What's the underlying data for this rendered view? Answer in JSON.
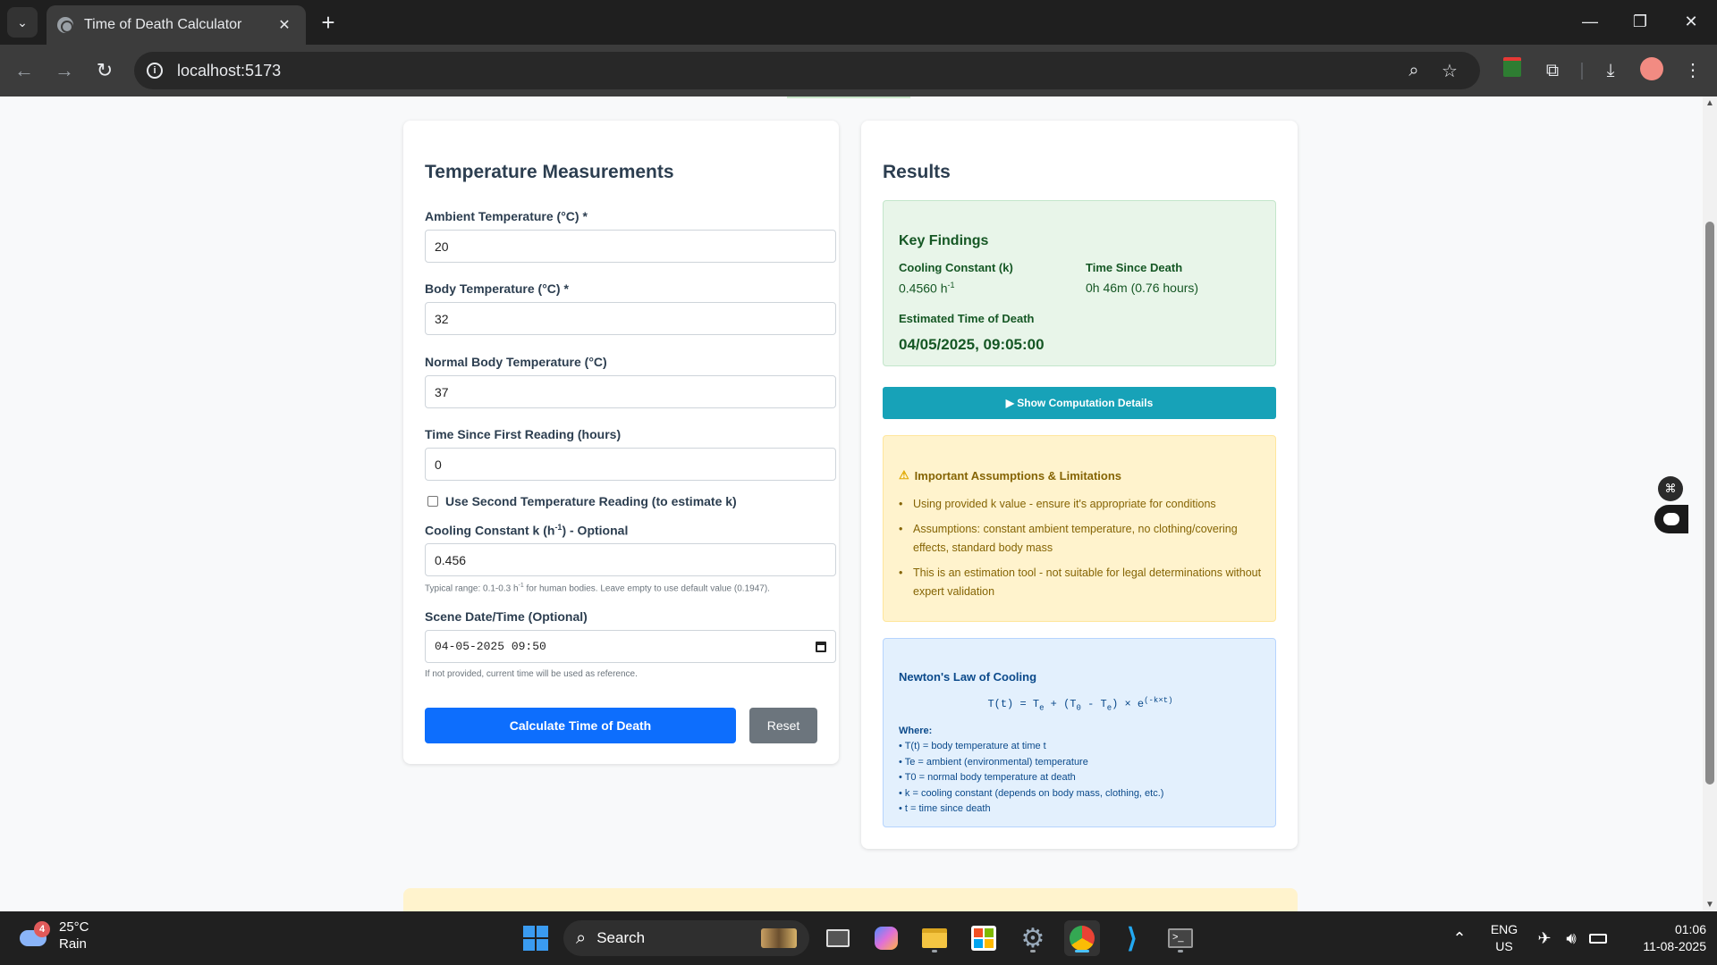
{
  "browser": {
    "tab_title": "Time of Death Calculator",
    "url": "localhost:5173",
    "new_tab": "+",
    "close_tab": "✕"
  },
  "form": {
    "title": "Temperature Measurements",
    "ambient_label": "Ambient Temperature (°C) *",
    "ambient_value": "20",
    "body_label": "Body Temperature (°C) *",
    "body_value": "32",
    "normal_label": "Normal Body Temperature (°C)",
    "normal_value": "37",
    "time_label": "Time Since First Reading (hours)",
    "time_value": "0",
    "second_reading_label": "Use Second Temperature Reading (to estimate k)",
    "k_label_prefix": "Cooling Constant k (h",
    "k_label_sup": "-1",
    "k_label_suffix": ") - Optional",
    "k_value": "0.456",
    "k_help_prefix": "Typical range: 0.1-0.3 h",
    "k_help_sup": "-1",
    "k_help_suffix": " for human bodies. Leave empty to use default value (0.1947).",
    "scene_label": "Scene Date/Time (Optional)",
    "scene_value": "04-05-2025 09:50",
    "scene_help": "If not provided, current time will be used as reference.",
    "calculate_button": "Calculate Time of Death",
    "reset_button": "Reset"
  },
  "results": {
    "title": "Results",
    "findings_title": "Key Findings",
    "k_label": "Cooling Constant (k)",
    "k_value": "0.4560 h",
    "k_value_sup": "-1",
    "tsd_label": "Time Since Death",
    "tsd_value": "0h 46m (0.76 hours)",
    "etd_label": "Estimated Time of Death",
    "etd_value": "04/05/2025, 09:05:00",
    "details_button": "▶ Show Computation Details",
    "assumptions_title": "Important Assumptions & Limitations",
    "assumptions": [
      "Using provided k value - ensure it's appropriate for conditions",
      "Assumptions: constant ambient temperature, no clothing/covering effects, standard body mass",
      "This is an estimation tool - not suitable for legal determinations without expert validation"
    ],
    "newton_title": "Newton's Law of Cooling",
    "formula_a": "T(t) = T",
    "formula_sub_e": "e",
    "formula_b": " + (T",
    "formula_sub_0": "0",
    "formula_c": " - T",
    "formula_d": ") × e",
    "formula_exp": "(-k×t)",
    "where_label": "Where:",
    "where_items": [
      "• T(t) = body temperature at time t",
      "• Te = ambient (environmental) temperature",
      "• T0 = normal body temperature at death",
      "• k = cooling constant (depends on body mass, clothing, etc.)",
      "• t = time since death"
    ]
  },
  "taskbar": {
    "weather_temp": "25°C",
    "weather_desc": "Rain",
    "weather_badge": "4",
    "search_placeholder": "Search",
    "lang_top": "ENG",
    "lang_bottom": "US",
    "time": "01:06",
    "date": "11-08-2025"
  },
  "colors": {
    "primary": "#0d6efd",
    "info": "#17a2b8",
    "success_bg": "#e8f5e9",
    "warning_bg": "#fff3cd",
    "newton_bg": "#e3f0fd"
  }
}
